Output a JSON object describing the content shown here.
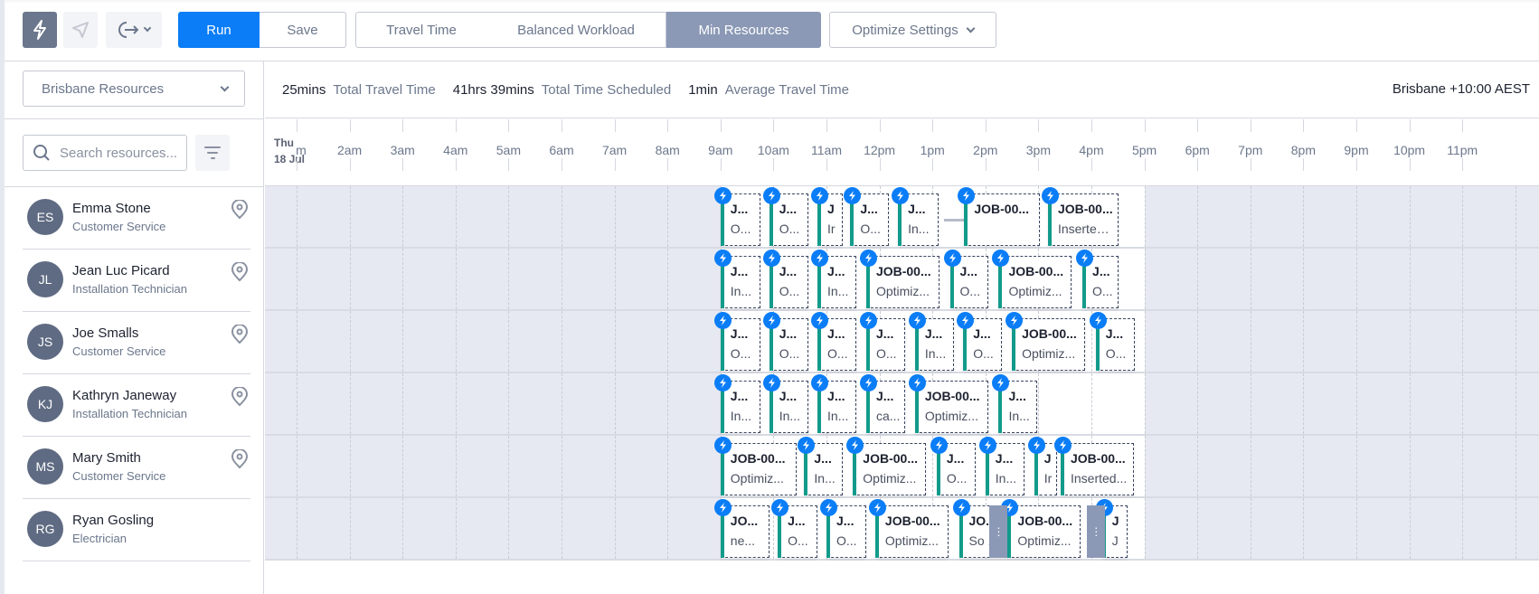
{
  "toolbar": {
    "bolt_icon": "lightning-bolt-icon",
    "send_icon": "paper-plane-icon",
    "exit_icon": "logout-icon",
    "run_label": "Run",
    "save_label": "Save",
    "modes": [
      "Travel Time",
      "Balanced Workload",
      "Min Resources"
    ],
    "active_mode": "Min Resources",
    "optimize_settings_label": "Optimize Settings"
  },
  "sidebar": {
    "resource_group": "Brisbane Resources",
    "search_placeholder": "Search resources...",
    "resources": [
      {
        "initials": "ES",
        "name": "Emma Stone",
        "role": "Customer Service",
        "has_location": true
      },
      {
        "initials": "JL",
        "name": "Jean Luc Picard",
        "role": "Installation Technician",
        "has_location": true
      },
      {
        "initials": "JS",
        "name": "Joe Smalls",
        "role": "Customer Service",
        "has_location": true
      },
      {
        "initials": "KJ",
        "name": "Kathryn Janeway",
        "role": "Installation Technician",
        "has_location": true
      },
      {
        "initials": "MS",
        "name": "Mary Smith",
        "role": "Customer Service",
        "has_location": true
      },
      {
        "initials": "RG",
        "name": "Ryan Gosling",
        "role": "Electrician",
        "has_location": false
      }
    ]
  },
  "stats": {
    "total_travel_value": "25mins",
    "total_travel_label": "Total Travel Time",
    "total_scheduled_value": "41hrs 39mins",
    "total_scheduled_label": "Total Time Scheduled",
    "avg_travel_value": "1min",
    "avg_travel_label": "Average Travel Time",
    "timezone": "Brisbane +10:00 AEST"
  },
  "timeline": {
    "day": "Thu",
    "date": "18 Jul",
    "hours": [
      "m",
      "2am",
      "3am",
      "4am",
      "5am",
      "6am",
      "7am",
      "8am",
      "9am",
      "10am",
      "11am",
      "12pm",
      "1pm",
      "2pm",
      "3pm",
      "4pm",
      "5pm",
      "6pm",
      "7pm",
      "8pm",
      "9pm",
      "10pm",
      "11pm"
    ],
    "working_hours": {
      "start": 9,
      "end": 17
    },
    "rows": [
      {
        "jobs": [
          {
            "start": 9.0,
            "end": 0.83,
            "t1": "J...",
            "t2": "O..."
          },
          {
            "start": 9.92,
            "end": 0.8,
            "t1": "J...",
            "t2": "O..."
          },
          {
            "start": 10.83,
            "end": 0.55,
            "t1": "J",
            "t2": "Ir"
          },
          {
            "start": 11.45,
            "end": 0.8,
            "t1": "J...",
            "t2": "O..."
          },
          {
            "start": 12.35,
            "end": 0.83,
            "t1": "J...",
            "t2": "In..."
          },
          {
            "start": 13.6,
            "end": 1.5,
            "t1": "JOB-00...",
            "t2": ""
          },
          {
            "start": 15.18,
            "end": 1.4,
            "t1": "JOB-00...",
            "t2": "Inserted..."
          }
        ],
        "travel": [
          {
            "start": 13.22,
            "end": 0.38
          }
        ]
      },
      {
        "jobs": [
          {
            "start": 9.0,
            "end": 0.83,
            "t1": "J...",
            "t2": "In..."
          },
          {
            "start": 9.92,
            "end": 0.8,
            "t1": "J...",
            "t2": "O..."
          },
          {
            "start": 10.83,
            "end": 0.8,
            "t1": "J...",
            "t2": "In..."
          },
          {
            "start": 11.75,
            "end": 1.45,
            "t1": "JOB-00...",
            "t2": "Optimiz..."
          },
          {
            "start": 13.33,
            "end": 0.8,
            "t1": "J...",
            "t2": "O..."
          },
          {
            "start": 14.25,
            "end": 1.45,
            "t1": "JOB-00...",
            "t2": "Optimiz..."
          },
          {
            "start": 15.83,
            "end": 0.75,
            "t1": "J...",
            "t2": "O..."
          }
        ]
      },
      {
        "jobs": [
          {
            "start": 9.0,
            "end": 0.83,
            "t1": "J...",
            "t2": "O..."
          },
          {
            "start": 9.92,
            "end": 0.8,
            "t1": "J...",
            "t2": "O..."
          },
          {
            "start": 10.83,
            "end": 0.8,
            "t1": "J...",
            "t2": "O..."
          },
          {
            "start": 11.75,
            "end": 0.8,
            "t1": "J...",
            "t2": "O..."
          },
          {
            "start": 12.67,
            "end": 0.8,
            "t1": "J...",
            "t2": "In..."
          },
          {
            "start": 13.58,
            "end": 0.8,
            "t1": "J...",
            "t2": "O..."
          },
          {
            "start": 14.5,
            "end": 1.45,
            "t1": "JOB-00...",
            "t2": "Optimiz..."
          },
          {
            "start": 16.08,
            "end": 0.8,
            "t1": "J...",
            "t2": "O..."
          }
        ]
      },
      {
        "jobs": [
          {
            "start": 9.0,
            "end": 0.83,
            "t1": "J...",
            "t2": "In..."
          },
          {
            "start": 9.92,
            "end": 0.8,
            "t1": "J...",
            "t2": "In..."
          },
          {
            "start": 10.83,
            "end": 0.8,
            "t1": "J...",
            "t2": "In..."
          },
          {
            "start": 11.75,
            "end": 0.8,
            "t1": "J...",
            "t2": "ca..."
          },
          {
            "start": 12.67,
            "end": 1.45,
            "t1": "JOB-00...",
            "t2": "Optimiz..."
          },
          {
            "start": 14.25,
            "end": 0.8,
            "t1": "J...",
            "t2": "In..."
          }
        ]
      },
      {
        "jobs": [
          {
            "start": 9.0,
            "end": 1.5,
            "t1": "JOB-00...",
            "t2": "Optimiz..."
          },
          {
            "start": 10.58,
            "end": 0.8,
            "t1": "J...",
            "t2": "In..."
          },
          {
            "start": 11.5,
            "end": 1.45,
            "t1": "JOB-00...",
            "t2": "Optimiz..."
          },
          {
            "start": 13.08,
            "end": 0.8,
            "t1": "J...",
            "t2": "O..."
          },
          {
            "start": 14.0,
            "end": 0.8,
            "t1": "J...",
            "t2": "In..."
          },
          {
            "start": 14.92,
            "end": 0.5,
            "t1": "J",
            "t2": "Ir"
          },
          {
            "start": 15.42,
            "end": 1.45,
            "t1": "JOB-00...",
            "t2": "Inserted..."
          }
        ]
      },
      {
        "jobs": [
          {
            "start": 9.0,
            "end": 1.0,
            "t1": "JO...",
            "t2": "ne..."
          },
          {
            "start": 10.08,
            "end": 0.82,
            "t1": "J...",
            "t2": "O..."
          },
          {
            "start": 11.0,
            "end": 0.82,
            "t1": "J...",
            "t2": "O..."
          },
          {
            "start": 11.92,
            "end": 1.45,
            "t1": "JOB-00...",
            "t2": "Optimiz..."
          },
          {
            "start": 13.5,
            "end": 1.0,
            "t1": "JO...",
            "t2": "So ..."
          },
          {
            "start": 14.42,
            "end": 1.45,
            "t1": "JOB-00...",
            "t2": "Optimiz..."
          },
          {
            "start": 16.2,
            "end": 0.55,
            "t1": "J",
            "t2": "J"
          }
        ],
        "handles": [
          14.08,
          15.92
        ]
      }
    ]
  },
  "colors": {
    "primary": "#0a7df7",
    "active_mode": "#8b99b6",
    "job_bar": "#129b8b",
    "avatar": "#5f6b82",
    "offhours": "#e6e9f2"
  }
}
